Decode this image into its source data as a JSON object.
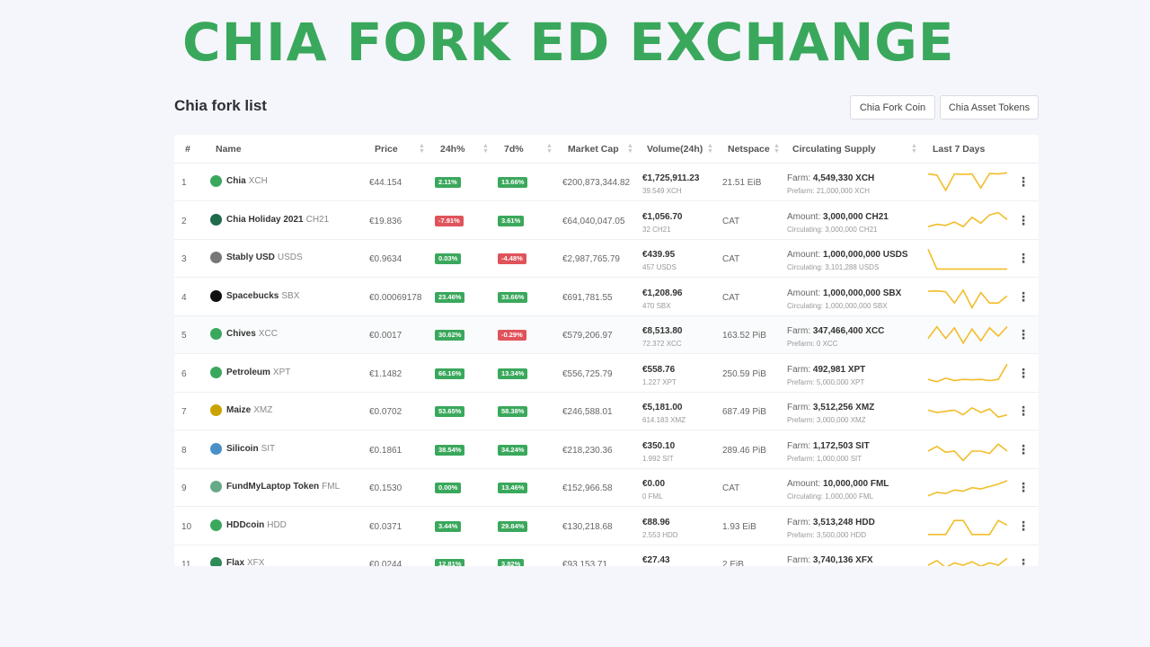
{
  "banner": "CHIA FORK ED EXCHANGE",
  "title": "Chia fork list",
  "tabs": [
    "Chia Fork Coin",
    "Chia Asset Tokens"
  ],
  "columns": [
    "#",
    "Name",
    "Price",
    "24h%",
    "7d%",
    "Market Cap",
    "Volume(24h)",
    "Netspace",
    "Circulating Supply",
    "Last 7 Days"
  ],
  "colors": {
    "accent": "#3aa85c",
    "up": "#3aa85c",
    "down": "#e0535a",
    "spark": "#f2bd2a"
  },
  "rows": [
    {
      "rank": "1",
      "name": "Chia",
      "symbol": "XCH",
      "icon": "chia-leaf-icon",
      "icon_color": "#3aa85c",
      "price": "€44.154",
      "h24": "2.11%",
      "h24_up": true,
      "d7": "13.66%",
      "d7_up": true,
      "mcap": "€200,873,344.82",
      "vol": "€1,725,911.23",
      "vol_sub": "39.549 XCH",
      "net": "21.51 EiB",
      "sup_label": "Farm:",
      "sup_value": "4,549,330 XCH",
      "sup_sub": "Prefarm: 21,000,000 XCH",
      "spark": [
        0.9,
        0.85,
        0.2,
        0.9,
        0.88,
        0.9,
        0.3,
        0.92,
        0.9,
        0.95
      ]
    },
    {
      "rank": "2",
      "name": "Chia Holiday 2021",
      "symbol": "CH21",
      "icon": "holiday-icon",
      "icon_color": "#1f6b4a",
      "price": "€19.836",
      "h24": "-7.91%",
      "h24_up": false,
      "d7": "3.61%",
      "d7_up": true,
      "mcap": "€64,040,047.05",
      "vol": "€1,056.70",
      "vol_sub": "32 CH21",
      "net": "CAT",
      "sup_label": "Amount:",
      "sup_value": "3,000,000 CH21",
      "sup_sub": "Circulating: 3,000,000 CH21",
      "spark": [
        0.3,
        0.4,
        0.35,
        0.5,
        0.3,
        0.7,
        0.45,
        0.8,
        0.9,
        0.6
      ]
    },
    {
      "rank": "3",
      "name": "Stably USD",
      "symbol": "USDS",
      "icon": "stably-icon",
      "icon_color": "#777",
      "price": "€0.9634",
      "h24": "0.03%",
      "h24_up": true,
      "d7": "-4.48%",
      "d7_up": false,
      "mcap": "€2,987,765.79",
      "vol": "€439.95",
      "vol_sub": "457 USDS",
      "net": "CAT",
      "sup_label": "Amount:",
      "sup_value": "1,000,000,000 USDS",
      "sup_sub": "Circulating: 3,101,288 USDS",
      "spark": [
        0.95,
        0.1,
        0.1,
        0.1,
        0.1,
        0.1,
        0.1,
        0.1,
        0.1,
        0.1
      ]
    },
    {
      "rank": "4",
      "name": "Spacebucks",
      "symbol": "SBX",
      "icon": "spacebucks-icon",
      "icon_color": "#111",
      "price": "€0.00069178",
      "h24": "23.46%",
      "h24_up": true,
      "d7": "33.66%",
      "d7_up": true,
      "mcap": "€691,781.55",
      "vol": "€1,208.96",
      "vol_sub": "470 SBX",
      "net": "CAT",
      "sup_label": "Amount:",
      "sup_value": "1,000,000,000 SBX",
      "sup_sub": "Circulating: 1,000,000,000 SBX",
      "spark": [
        0.8,
        0.82,
        0.78,
        0.3,
        0.85,
        0.1,
        0.75,
        0.3,
        0.3,
        0.6
      ]
    },
    {
      "rank": "5",
      "name": "Chives",
      "symbol": "XCC",
      "icon": "chives-icon",
      "icon_color": "#3aa85c",
      "price": "€0.0017",
      "h24": "30.62%",
      "h24_up": true,
      "d7": "-0.29%",
      "d7_up": false,
      "mcap": "€579,206.97",
      "vol": "€8,513.80",
      "vol_sub": "72.372 XCC",
      "net": "163.52 PiB",
      "sup_label": "Farm:",
      "sup_value": "347,466,400 XCC",
      "sup_sub": "Prefarm: 0 XCC",
      "spark": [
        0.4,
        0.9,
        0.4,
        0.85,
        0.2,
        0.8,
        0.3,
        0.85,
        0.5,
        0.9
      ]
    },
    {
      "rank": "6",
      "name": "Petroleum",
      "symbol": "XPT",
      "icon": "petroleum-icon",
      "icon_color": "#3aa85c",
      "price": "€1.1482",
      "h24": "66.16%",
      "h24_up": true,
      "d7": "13.34%",
      "d7_up": true,
      "mcap": "€556,725.79",
      "vol": "€558.76",
      "vol_sub": "1.227 XPT",
      "net": "250.59 PiB",
      "sup_label": "Farm:",
      "sup_value": "492,981 XPT",
      "sup_sub": "Prefarm: 5,000,000 XPT",
      "spark": [
        0.3,
        0.2,
        0.35,
        0.25,
        0.3,
        0.28,
        0.3,
        0.25,
        0.3,
        0.95
      ]
    },
    {
      "rank": "7",
      "name": "Maize",
      "symbol": "XMZ",
      "icon": "maize-icon",
      "icon_color": "#c9a400",
      "price": "€0.0702",
      "h24": "53.65%",
      "h24_up": true,
      "d7": "58.38%",
      "d7_up": true,
      "mcap": "€246,588.01",
      "vol": "€5,181.00",
      "vol_sub": "614.183 XMZ",
      "net": "687.49 PiB",
      "sup_label": "Farm:",
      "sup_value": "3,512,256 XMZ",
      "sup_sub": "Prefarm: 3,000,000 XMZ",
      "spark": [
        0.6,
        0.5,
        0.55,
        0.6,
        0.4,
        0.7,
        0.5,
        0.65,
        0.3,
        0.4
      ]
    },
    {
      "rank": "8",
      "name": "Silicoin",
      "symbol": "SIT",
      "icon": "silicoin-icon",
      "icon_color": "#4a90c8",
      "price": "€0.1861",
      "h24": "38.54%",
      "h24_up": true,
      "d7": "34.24%",
      "d7_up": true,
      "mcap": "€218,230.36",
      "vol": "€350.10",
      "vol_sub": "1.992 SIT",
      "net": "289.46 PiB",
      "sup_label": "Farm:",
      "sup_value": "1,172,503 SIT",
      "sup_sub": "Prefarm: 1,000,000 SIT",
      "spark": [
        0.5,
        0.7,
        0.45,
        0.5,
        0.1,
        0.5,
        0.5,
        0.4,
        0.8,
        0.5
      ]
    },
    {
      "rank": "9",
      "name": "FundMyLaptop Token",
      "symbol": "FML",
      "icon": "fml-icon",
      "icon_color": "#6a8",
      "price": "€0.1530",
      "h24": "0.00%",
      "h24_up": true,
      "d7": "13.46%",
      "d7_up": true,
      "mcap": "€152,966.58",
      "vol": "€0.00",
      "vol_sub": "0 FML",
      "net": "CAT",
      "sup_label": "Amount:",
      "sup_value": "10,000,000 FML",
      "sup_sub": "Circulating: 1,000,000 FML",
      "spark": [
        0.2,
        0.35,
        0.3,
        0.45,
        0.4,
        0.55,
        0.5,
        0.6,
        0.7,
        0.85
      ]
    },
    {
      "rank": "10",
      "name": "HDDcoin",
      "symbol": "HDD",
      "icon": "hddcoin-icon",
      "icon_color": "#3aa85c",
      "price": "€0.0371",
      "h24": "3.44%",
      "h24_up": true,
      "d7": "29.84%",
      "d7_up": true,
      "mcap": "€130,218.68",
      "vol": "€88.96",
      "vol_sub": "2.553 HDD",
      "net": "1.93 EiB",
      "sup_label": "Farm:",
      "sup_value": "3,513,248 HDD",
      "sup_sub": "Prefarm: 3,500,000 HDD",
      "spark": [
        0.2,
        0.2,
        0.2,
        0.8,
        0.8,
        0.2,
        0.2,
        0.2,
        0.8,
        0.6
      ]
    },
    {
      "rank": "11",
      "name": "Flax",
      "symbol": "XFX",
      "icon": "flax-icon",
      "icon_color": "#2e8b57",
      "price": "€0.0244",
      "h24": "12.81%",
      "h24_up": true,
      "d7": "3.82%",
      "d7_up": true,
      "mcap": "€93,153.71",
      "vol": "€27.43",
      "vol_sub": "",
      "net": "2 EiB",
      "sup_label": "Farm:",
      "sup_value": "3,740,136 XFX",
      "sup_sub": "",
      "spark": [
        0.5,
        0.7,
        0.4,
        0.6,
        0.5,
        0.65,
        0.45,
        0.6,
        0.5,
        0.8
      ]
    }
  ]
}
